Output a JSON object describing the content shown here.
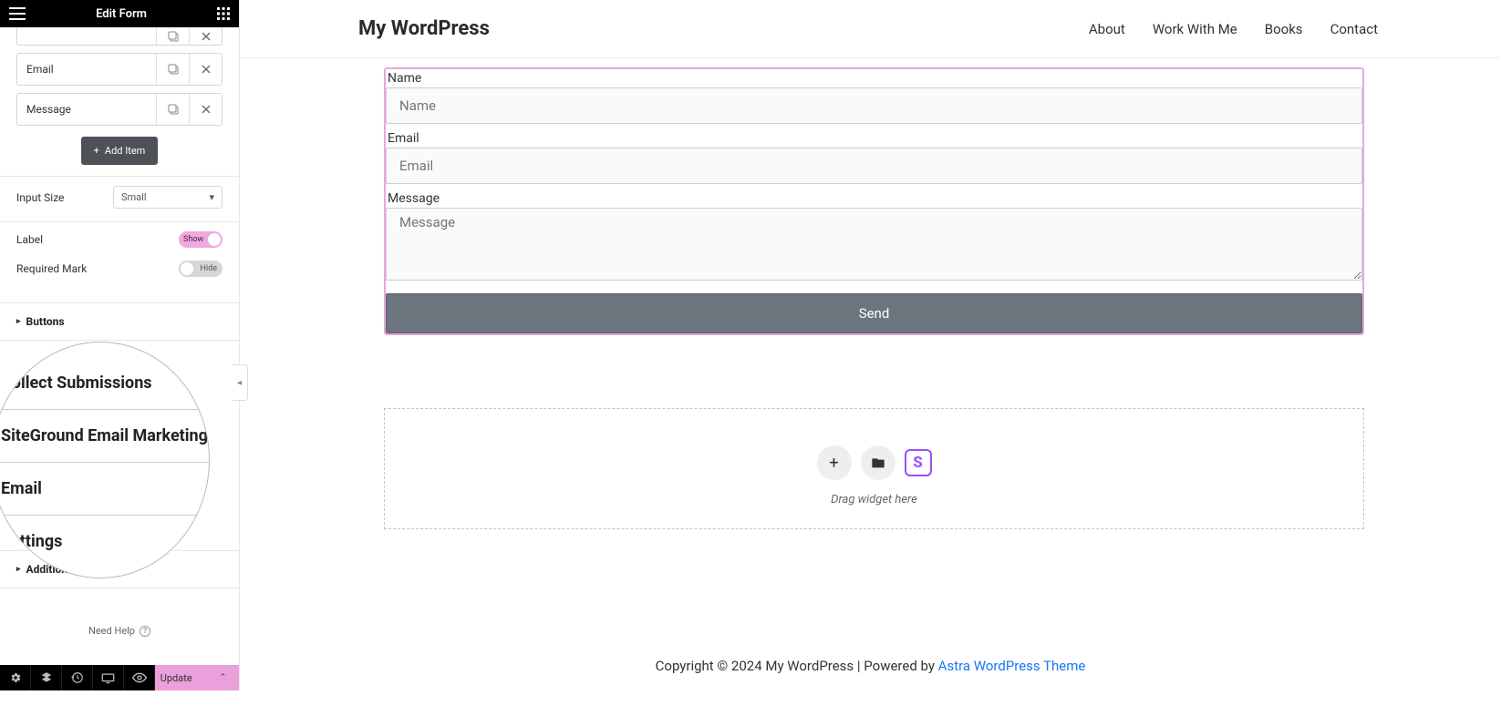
{
  "sidebar": {
    "title": "Edit Form",
    "fields": [
      {
        "label": ""
      },
      {
        "label": "Email"
      },
      {
        "label": "Message"
      }
    ],
    "add_item_label": "Add Item",
    "input_size_label": "Input Size",
    "input_size_value": "Small",
    "label_label": "Label",
    "label_toggle": "Show",
    "required_label": "Required Mark",
    "required_toggle": "Hide",
    "buttons_section": "Buttons",
    "additional_options": "Additional Options",
    "need_help": "Need Help"
  },
  "magnify": {
    "row1": "Collect Submissions",
    "row2": "SiteGround Email Marketing",
    "row3": "Email",
    "row4": "Settings"
  },
  "bottombar": {
    "update": "Update"
  },
  "header": {
    "site_title": "My WordPress",
    "nav": [
      "About",
      "Work With Me",
      "Books",
      "Contact"
    ]
  },
  "form": {
    "name_label": "Name",
    "name_placeholder": "Name",
    "email_label": "Email",
    "email_placeholder": "Email",
    "message_label": "Message",
    "message_placeholder": "Message",
    "send": "Send"
  },
  "dropzone": {
    "hint": "Drag widget here"
  },
  "footer": {
    "text": "Copyright © 2024 My WordPress | Powered by ",
    "link": "Astra WordPress Theme"
  }
}
